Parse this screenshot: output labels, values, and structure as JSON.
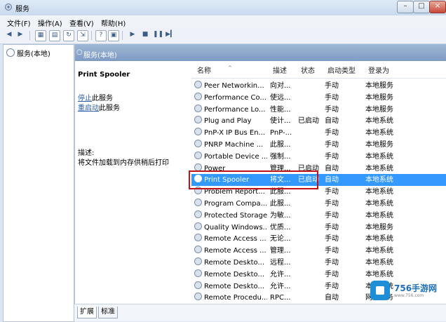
{
  "window": {
    "title": "服务"
  },
  "menu": [
    "文件(F)",
    "操作(A)",
    "查看(V)",
    "帮助(H)"
  ],
  "tree": {
    "item": "服务(本地)"
  },
  "main": {
    "header": "服务(本地)"
  },
  "detail": {
    "service_name": "Print Spooler",
    "stop_link": "停止",
    "stop_suffix": "此服务",
    "restart_link": "重启动",
    "restart_suffix": "此服务",
    "desc_label": "描述:",
    "desc_text": "将文件加载到内存供稍后打印"
  },
  "list": {
    "headers": [
      "名称",
      "描述",
      "状态",
      "启动类型",
      "登录为"
    ],
    "rows": [
      [
        "Peer Networkin...",
        "向对...",
        "",
        "手动",
        "本地服务"
      ],
      [
        "Performance Co...",
        "使远...",
        "",
        "手动",
        "本地服务"
      ],
      [
        "Performance Lo...",
        "性能...",
        "",
        "手动",
        "本地服务"
      ],
      [
        "Plug and Play",
        "使计...",
        "已启动",
        "自动",
        "本地系统"
      ],
      [
        "PnP-X IP Bus En...",
        "PnP-...",
        "",
        "手动",
        "本地系统"
      ],
      [
        "PNRP Machine ...",
        "此服...",
        "",
        "手动",
        "本地服务"
      ],
      [
        "Portable Device ...",
        "强制...",
        "",
        "手动",
        "本地系统"
      ],
      [
        "Power",
        "管理...",
        "已启动",
        "自动",
        "本地系统"
      ],
      [
        "Print Spooler",
        "将文...",
        "已启动",
        "自动",
        "本地系统"
      ],
      [
        "Problem Report...",
        "此服...",
        "",
        "手动",
        "本地系统"
      ],
      [
        "Program Compa...",
        "此服...",
        "",
        "手动",
        "本地系统"
      ],
      [
        "Protected Storage",
        "为敏...",
        "",
        "手动",
        "本地系统"
      ],
      [
        "Quality Windows...",
        "优质...",
        "",
        "手动",
        "本地服务"
      ],
      [
        "Remote Access ...",
        "无论...",
        "",
        "手动",
        "本地系统"
      ],
      [
        "Remote Access ...",
        "管理...",
        "",
        "手动",
        "本地系统"
      ],
      [
        "Remote Deskto...",
        "远程...",
        "",
        "手动",
        "本地系统"
      ],
      [
        "Remote Deskto...",
        "允许...",
        "",
        "手动",
        "本地系统"
      ],
      [
        "Remote Deskto...",
        "允许...",
        "",
        "手动",
        "本地系统"
      ],
      [
        "Remote Procedu...",
        "RPC...",
        "",
        "自动",
        "网络服务"
      ]
    ],
    "selected_index": 8
  },
  "tabs": [
    "扩展",
    "标准"
  ],
  "watermark": {
    "brand": "756手游网",
    "url": "www.756.com"
  }
}
